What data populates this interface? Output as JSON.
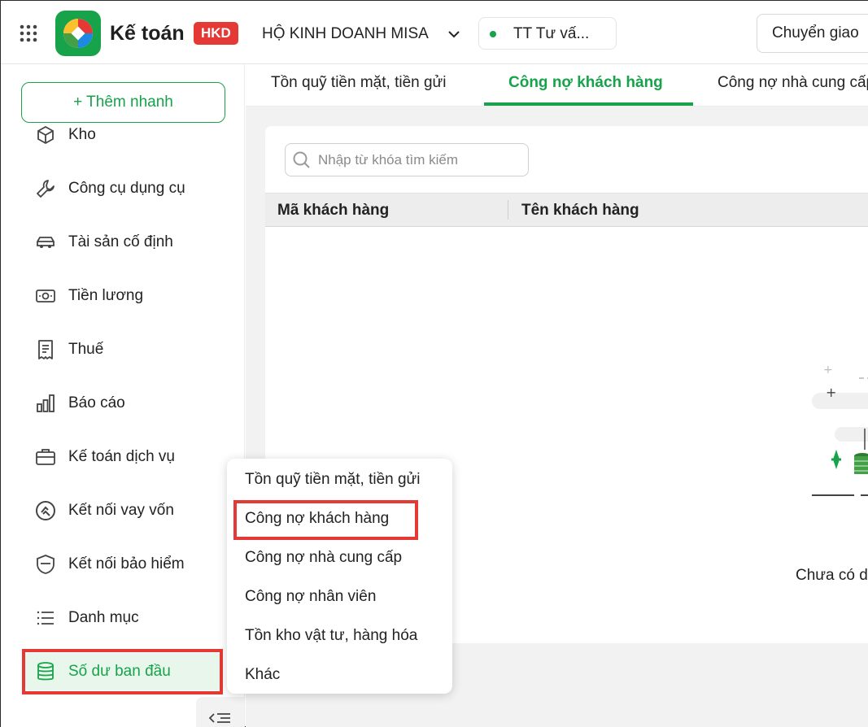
{
  "header": {
    "app_title": "Kế toán",
    "badge": "HKD",
    "company_name": "HỘ KINH DOANH MISA",
    "branch_name": "TT Tư vấ...",
    "transfer_button": "Chuyển giao"
  },
  "sidebar": {
    "quick_add": "+ Thêm nhanh",
    "items": [
      {
        "label": "Kho",
        "icon": "box-icon"
      },
      {
        "label": "Công cụ dụng cụ",
        "icon": "wrench-icon"
      },
      {
        "label": "Tài sản cố định",
        "icon": "car-icon"
      },
      {
        "label": "Tiền lương",
        "icon": "money-icon"
      },
      {
        "label": "Thuế",
        "icon": "receipt-icon"
      },
      {
        "label": "Báo cáo",
        "icon": "bar-chart-icon"
      },
      {
        "label": "Kế toán dịch vụ",
        "icon": "briefcase-icon"
      },
      {
        "label": "Kết nối vay vốn",
        "icon": "loan-icon"
      },
      {
        "label": "Kết nối bảo hiểm",
        "icon": "shield-icon"
      },
      {
        "label": "Danh mục",
        "icon": "list-icon"
      },
      {
        "label": "Số dư ban đầu",
        "icon": "database-icon",
        "active": true
      }
    ]
  },
  "tabs": [
    {
      "label": "Tồn quỹ tiền mặt, tiền gửi"
    },
    {
      "label": "Công nợ khách hàng",
      "active": true
    },
    {
      "label": "Công nợ nhà cung cấp"
    }
  ],
  "search": {
    "placeholder": "Nhập từ khóa tìm kiếm"
  },
  "table": {
    "columns": [
      "Mã khách hàng",
      "Tên khách hàng"
    ],
    "empty_text": "Chưa có dữ liệu"
  },
  "popup": {
    "items": [
      "Tồn quỹ tiền mặt, tiền gửi",
      "Công nợ khách hàng",
      "Công nợ nhà cung cấp",
      "Công nợ nhân viên",
      "Tồn kho vật tư, hàng hóa",
      "Khác"
    ],
    "highlighted": "Công nợ khách hàng"
  },
  "colors": {
    "accent": "#16a34a",
    "badge": "#e53935",
    "highlight": "#e53935"
  }
}
